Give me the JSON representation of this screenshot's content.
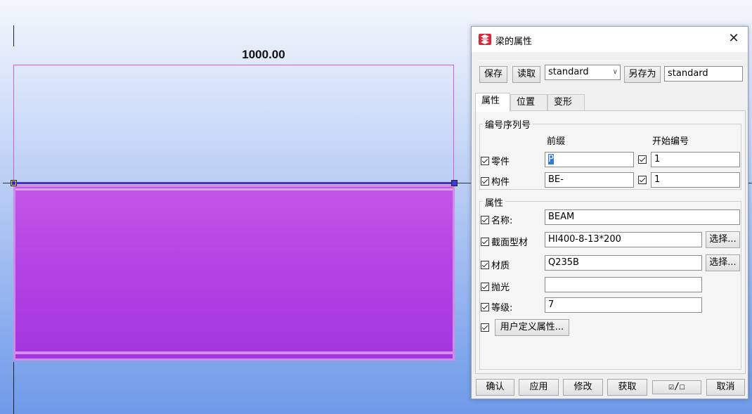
{
  "viewport": {
    "dimension_label": "1000.00"
  },
  "dialog": {
    "title": "梁的属性",
    "close_glyph": "✕",
    "toolbar": {
      "save_label": "保存",
      "load_label": "读取",
      "preset_value": "standard",
      "save_as_label": "另存为",
      "save_as_value": "standard"
    },
    "tabs": [
      {
        "label": "属性",
        "active": true
      },
      {
        "label": "位置",
        "active": false
      },
      {
        "label": "变形",
        "active": false
      }
    ],
    "numbering": {
      "legend": "编号序列号",
      "col_prefix": "前缀",
      "col_start": "开始编号",
      "part_label": "零件",
      "part_prefix": "P",
      "part_start": "1",
      "assembly_label": "构件",
      "assembly_prefix": "BE-",
      "assembly_start": "1"
    },
    "attributes": {
      "legend": "属性",
      "name_label": "名称:",
      "name_value": "BEAM",
      "profile_label": "截面型材",
      "profile_value": "HI400-8-13*200",
      "profile_select": "选择...",
      "material_label": "材质",
      "material_value": "Q235B",
      "material_select": "选择...",
      "finish_label": "抛光",
      "finish_value": "",
      "class_label": "等级:",
      "class_value": "7",
      "udf_label": "用户定义属性..."
    },
    "footer": {
      "ok_label": "确认",
      "apply_label": "应用",
      "modify_label": "修改",
      "get_label": "获取",
      "toggle_label": "☑/☐",
      "cancel_label": "取消"
    }
  }
}
